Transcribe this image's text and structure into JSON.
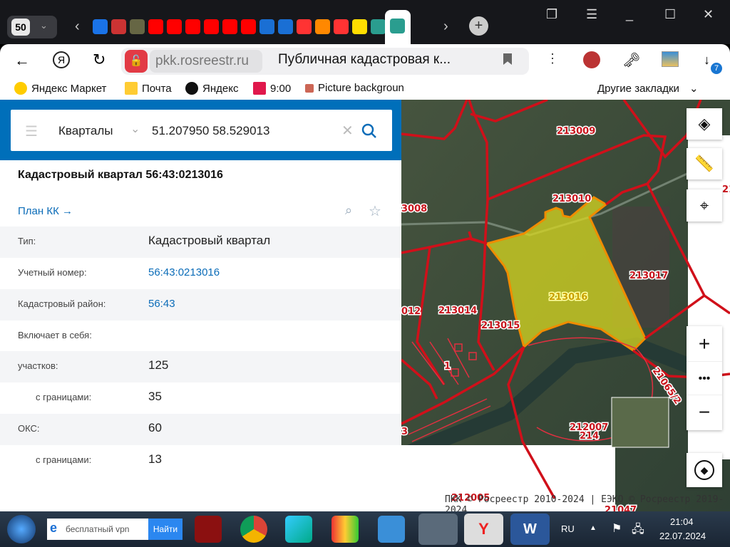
{
  "browser": {
    "tab_count": "50",
    "tab_icons": [
      "messenger-icon",
      "tomato-icon",
      "harp-icon",
      "youtube-icon",
      "youtube-icon",
      "youtube-icon",
      "youtube-icon",
      "youtube-icon",
      "youtube-icon",
      "mail-at-icon",
      "mail-envelope-icon",
      "yandex-icon",
      "odnoklassniki-icon",
      "yandex-icon",
      "tc-icon",
      "rosreestr-icon",
      "tc-icon"
    ],
    "address_domain": "pkk.rosreestr.ru",
    "page_title": "Публичная кадастровая к...",
    "downloads_badge": "7",
    "bookmarks": [
      "Яндекс Маркет",
      "Почта",
      "Яндекс",
      "9:00",
      "Picture backgroun"
    ],
    "other_bookmarks": "Другие закладки"
  },
  "search": {
    "layer": "Кварталы",
    "query": "51.207950 58.529013"
  },
  "panel": {
    "title": "Кадастровый квартал 56:43:0213016",
    "plan_link": "План КК →",
    "rows": [
      {
        "label": "Тип:",
        "value": "Кадастровый квартал"
      },
      {
        "label": "Учетный номер:",
        "value": "56:43:0213016"
      },
      {
        "label": "Кадастровый район:",
        "value": "56:43"
      },
      {
        "label": "Включает в себя:",
        "value": ""
      },
      {
        "label": "участков:",
        "value": "125"
      },
      {
        "label": "с границами:",
        "value": "35"
      },
      {
        "label": "ОКС:",
        "value": "60"
      },
      {
        "label": "с границами:",
        "value": "13"
      }
    ]
  },
  "map": {
    "labels": [
      "213009",
      "213010",
      "3008",
      "213017",
      "213016",
      "213014",
      "213015",
      "012",
      "1",
      "212007",
      "214",
      "21065/2",
      "3",
      "212005",
      "21047",
      "21"
    ],
    "attribution": "ПКК © Росреестр 2010-2024 | ЕЭКО © Росреестр 2019-2024",
    "colors": {
      "boundary": "#d0101a",
      "selected_fill": "#d8d820",
      "selected_stroke": "#f08c00"
    }
  },
  "taskbar": {
    "search_value": "бесплатный vpn",
    "search_button": "Найти",
    "lang": "RU",
    "time": "21:04",
    "date": "22.07.2024"
  }
}
